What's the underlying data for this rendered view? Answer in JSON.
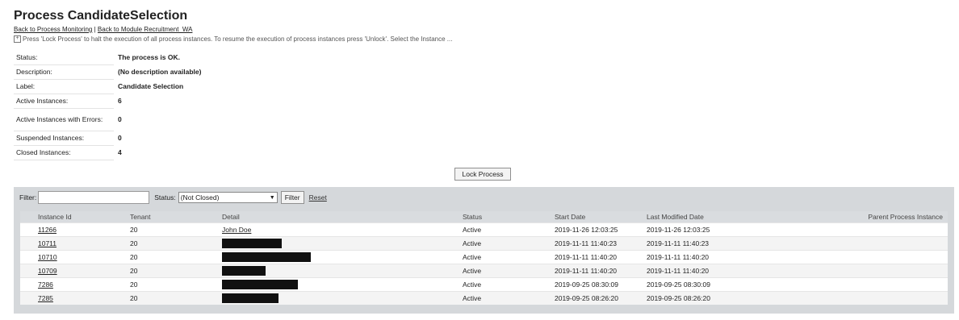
{
  "page": {
    "title": "Process CandidateSelection",
    "links": [
      "Back to Process Monitoring",
      "Back to Module Recruitment_WA"
    ],
    "separator": "|",
    "hint_icon": "plus-box-icon",
    "hint": "Press 'Lock Process' to halt the execution of all process instances. To resume the execution of process instances press 'Unlock'. Select the Instance ..."
  },
  "info": [
    {
      "key": "Status:",
      "value": "The process is OK."
    },
    {
      "key": "Description:",
      "value": "(No description available)"
    },
    {
      "key": "Label:",
      "value": "Candidate Selection"
    },
    {
      "key": "Active Instances:",
      "value": "6"
    },
    {
      "key": "Active Instances with Errors:",
      "value": "0"
    },
    {
      "key": "Suspended Instances:",
      "value": "0"
    },
    {
      "key": "Closed Instances:",
      "value": "4"
    }
  ],
  "lock_button": "Lock Process",
  "filter": {
    "label": "Filter:",
    "value": "",
    "status_label": "Status:",
    "status_selected": "(Not Closed)",
    "filter_button": "Filter",
    "reset_link": "Reset"
  },
  "table": {
    "columns": [
      "Instance Id",
      "Tenant",
      "Detail",
      "Status",
      "Start Date",
      "Last Modified Date",
      "Parent Process Instance"
    ],
    "rows": [
      {
        "id": "11266",
        "tenant": "20",
        "detail": "John Doe",
        "status": "Active",
        "start": "2019-11-26 12:03:25",
        "modified": "2019-11-26 12:03:25",
        "parent": ""
      },
      {
        "id": "10711",
        "tenant": "20",
        "detail": "",
        "status": "Active",
        "start": "2019-11-11 11:40:23",
        "modified": "2019-11-11 11:40:23",
        "parent": ""
      },
      {
        "id": "10710",
        "tenant": "20",
        "detail": "",
        "status": "Active",
        "start": "2019-11-11 11:40:20",
        "modified": "2019-11-11 11:40:20",
        "parent": ""
      },
      {
        "id": "10709",
        "tenant": "20",
        "detail": "",
        "status": "Active",
        "start": "2019-11-11 11:40:20",
        "modified": "2019-11-11 11:40:20",
        "parent": ""
      },
      {
        "id": "7286",
        "tenant": "20",
        "detail": "",
        "status": "Active",
        "start": "2019-09-25 08:30:09",
        "modified": "2019-09-25 08:30:09",
        "parent": ""
      },
      {
        "id": "7285",
        "tenant": "20",
        "detail": "",
        "status": "Active",
        "start": "2019-09-25 08:26:20",
        "modified": "2019-09-25 08:26:20",
        "parent": ""
      }
    ]
  }
}
